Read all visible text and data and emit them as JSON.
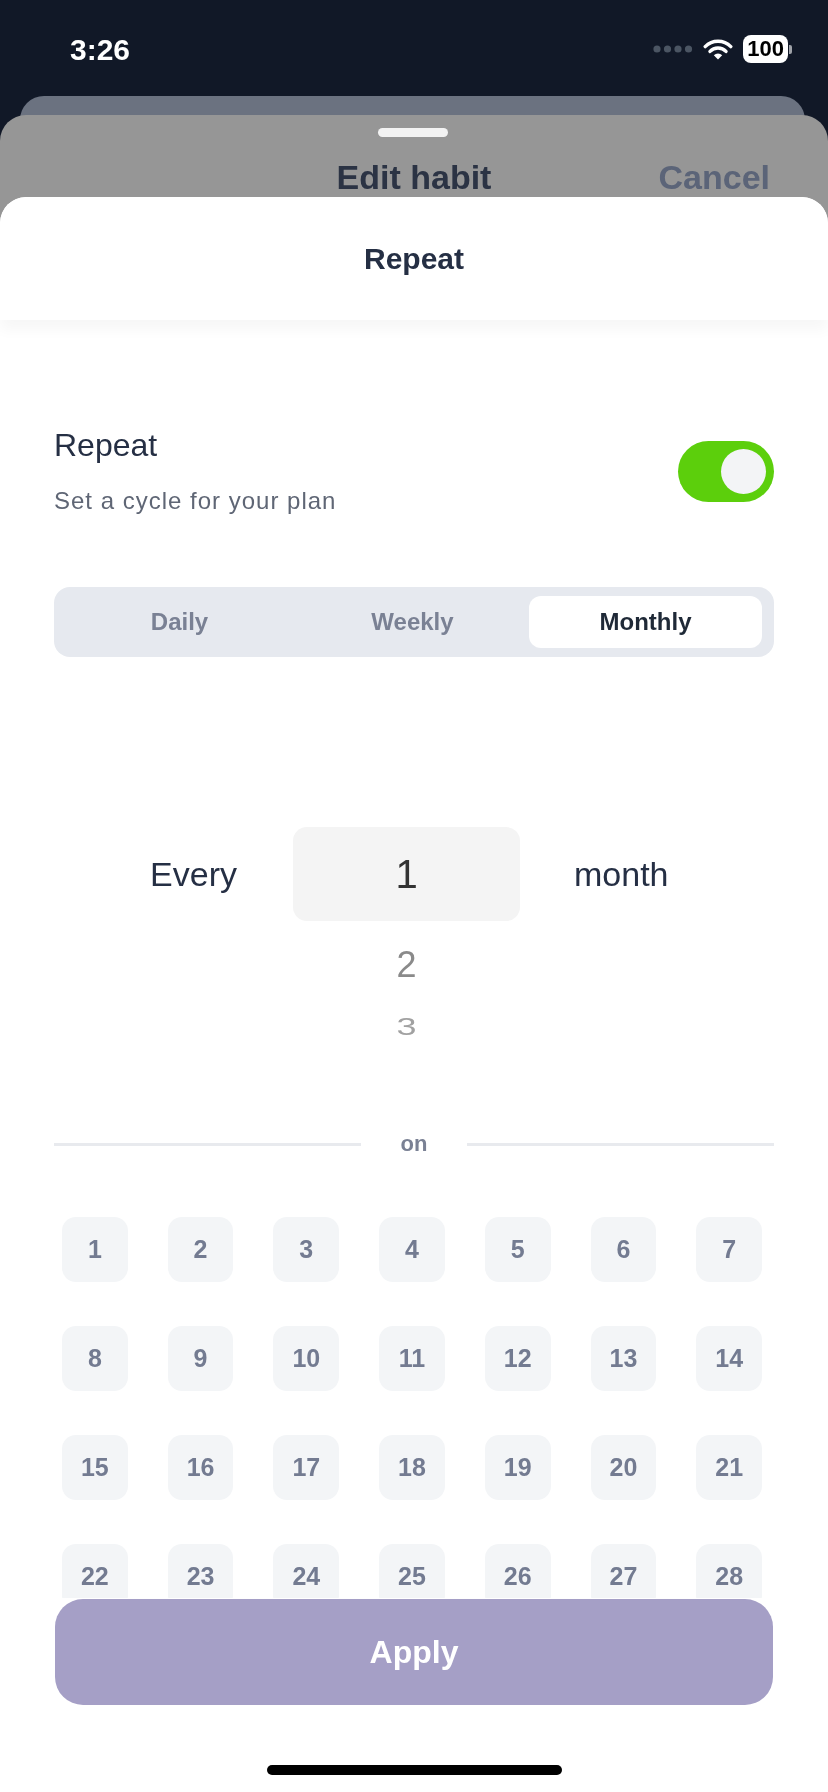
{
  "status_bar": {
    "time": "3:26",
    "battery": "100"
  },
  "parent_sheet": {
    "title": "Edit habit",
    "action": "Cancel"
  },
  "sheet": {
    "title": "Repeat"
  },
  "repeat": {
    "label": "Repeat",
    "description": "Set a cycle for your plan",
    "on": true
  },
  "frequency_tabs": [
    {
      "label": "Daily",
      "selected": false
    },
    {
      "label": "Weekly",
      "selected": false
    },
    {
      "label": "Monthly",
      "selected": true
    }
  ],
  "interval": {
    "prefix": "Every",
    "unit": "month",
    "options": [
      {
        "label": "1",
        "selected": true
      },
      {
        "label": "2",
        "selected": false
      },
      {
        "label": "3",
        "selected": false
      }
    ]
  },
  "days_divider": "on",
  "days": [
    {
      "label": "1",
      "selected": false
    },
    {
      "label": "2",
      "selected": false
    },
    {
      "label": "3",
      "selected": false
    },
    {
      "label": "4",
      "selected": false
    },
    {
      "label": "5",
      "selected": false
    },
    {
      "label": "6",
      "selected": false
    },
    {
      "label": "7",
      "selected": false
    },
    {
      "label": "8",
      "selected": false
    },
    {
      "label": "9",
      "selected": false
    },
    {
      "label": "10",
      "selected": false
    },
    {
      "label": "11",
      "selected": false
    },
    {
      "label": "12",
      "selected": false
    },
    {
      "label": "13",
      "selected": false
    },
    {
      "label": "14",
      "selected": false
    },
    {
      "label": "15",
      "selected": false
    },
    {
      "label": "16",
      "selected": false
    },
    {
      "label": "17",
      "selected": false
    },
    {
      "label": "18",
      "selected": false
    },
    {
      "label": "19",
      "selected": false
    },
    {
      "label": "20",
      "selected": false
    },
    {
      "label": "21",
      "selected": false
    },
    {
      "label": "22",
      "selected": false
    },
    {
      "label": "23",
      "selected": false
    },
    {
      "label": "24",
      "selected": false
    },
    {
      "label": "25",
      "selected": false
    },
    {
      "label": "26",
      "selected": false
    },
    {
      "label": "27",
      "selected": false
    },
    {
      "label": "28",
      "selected": false
    }
  ],
  "apply_button": {
    "label": "Apply",
    "disabled": true
  }
}
